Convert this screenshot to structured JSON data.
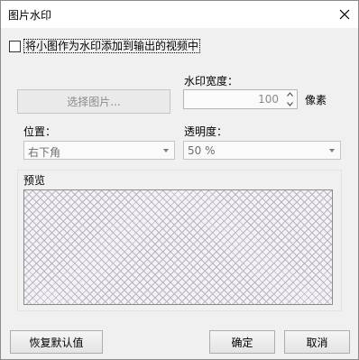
{
  "window": {
    "title": "图片水印",
    "close_icon": "close-icon"
  },
  "options": {
    "add_to_output_label": "将小图作为水印添加到输出的视频中",
    "add_to_output_checked": false
  },
  "image": {
    "select_button_label": "选择图片...",
    "select_button_enabled": false
  },
  "width": {
    "label": "水印宽度：",
    "value": "100",
    "unit": "像素"
  },
  "position": {
    "label": "位置：",
    "selected": "右下角"
  },
  "opacity": {
    "label": "透明度：",
    "selected": "50 %"
  },
  "preview": {
    "label": "预览"
  },
  "footer": {
    "restore_defaults_label": "恢复默认值",
    "ok_label": "确定",
    "cancel_label": "取消"
  }
}
